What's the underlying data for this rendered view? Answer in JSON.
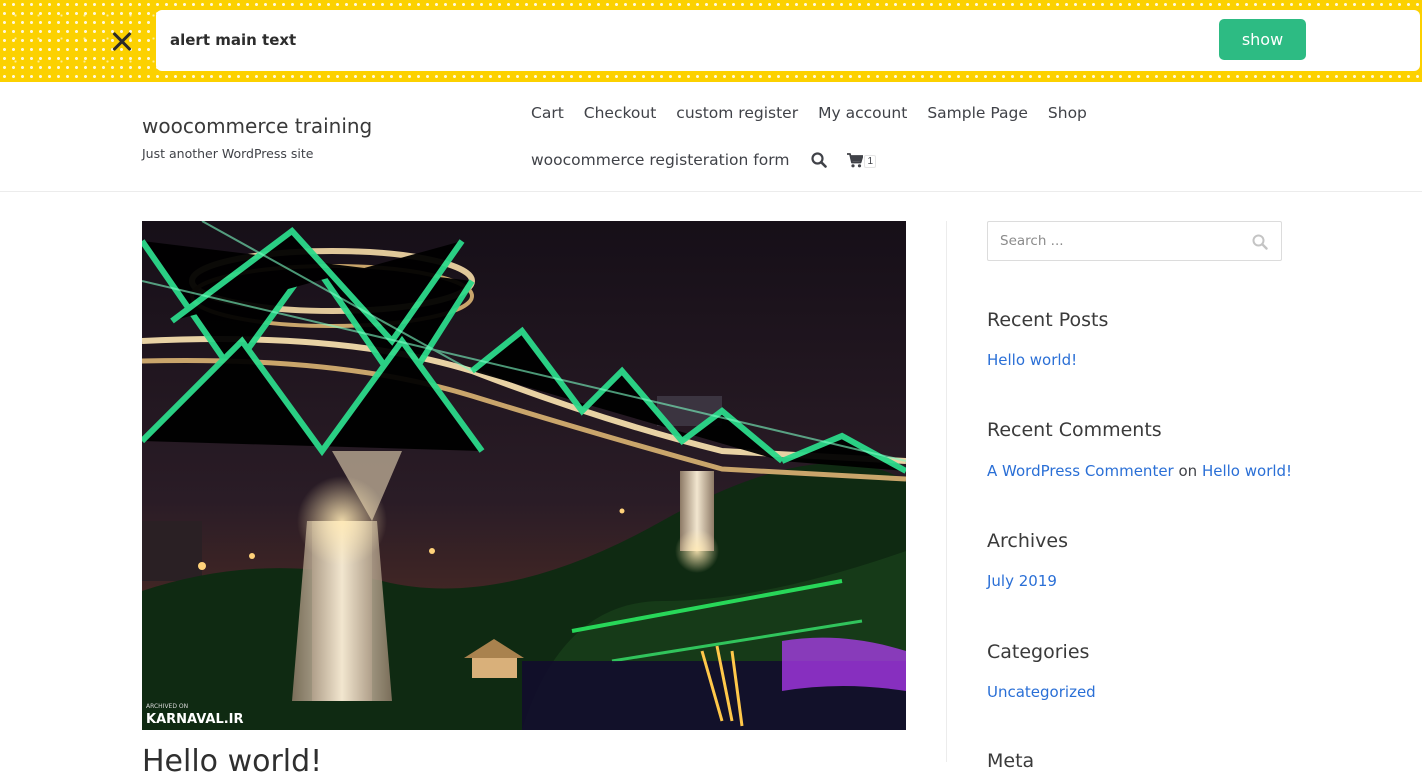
{
  "alert": {
    "text": "alert main text",
    "button_label": "show",
    "accent_color": "#fcd100",
    "button_color": "#2dbb83",
    "close_icon": "close-icon"
  },
  "header": {
    "site_title": "woocommerce training",
    "tagline": "Just another WordPress site",
    "nav_row1": [
      "Cart",
      "Checkout",
      "custom register",
      "My account",
      "Sample Page",
      "Shop"
    ],
    "nav_row2_label": "woocommerce registeration form",
    "search_icon": "search-icon",
    "cart_icon": "cart-icon",
    "cart_count": "1"
  },
  "main": {
    "featured_image_caption": "KARNAVAL.IR",
    "featured_image_small_caption": "ARCHIVED ON",
    "post_title": "Hello world!"
  },
  "sidebar": {
    "search_placeholder": "Search ...",
    "recent_posts": {
      "title": "Recent Posts",
      "items": [
        "Hello world!"
      ]
    },
    "recent_comments": {
      "title": "Recent Comments",
      "author": "A WordPress Commenter",
      "on": "on",
      "post": "Hello world!"
    },
    "archives": {
      "title": "Archives",
      "items": [
        "July 2019"
      ]
    },
    "categories": {
      "title": "Categories",
      "items": [
        "Uncategorized"
      ]
    },
    "meta": {
      "title": "Meta"
    },
    "link_color": "#2a6fd6"
  }
}
